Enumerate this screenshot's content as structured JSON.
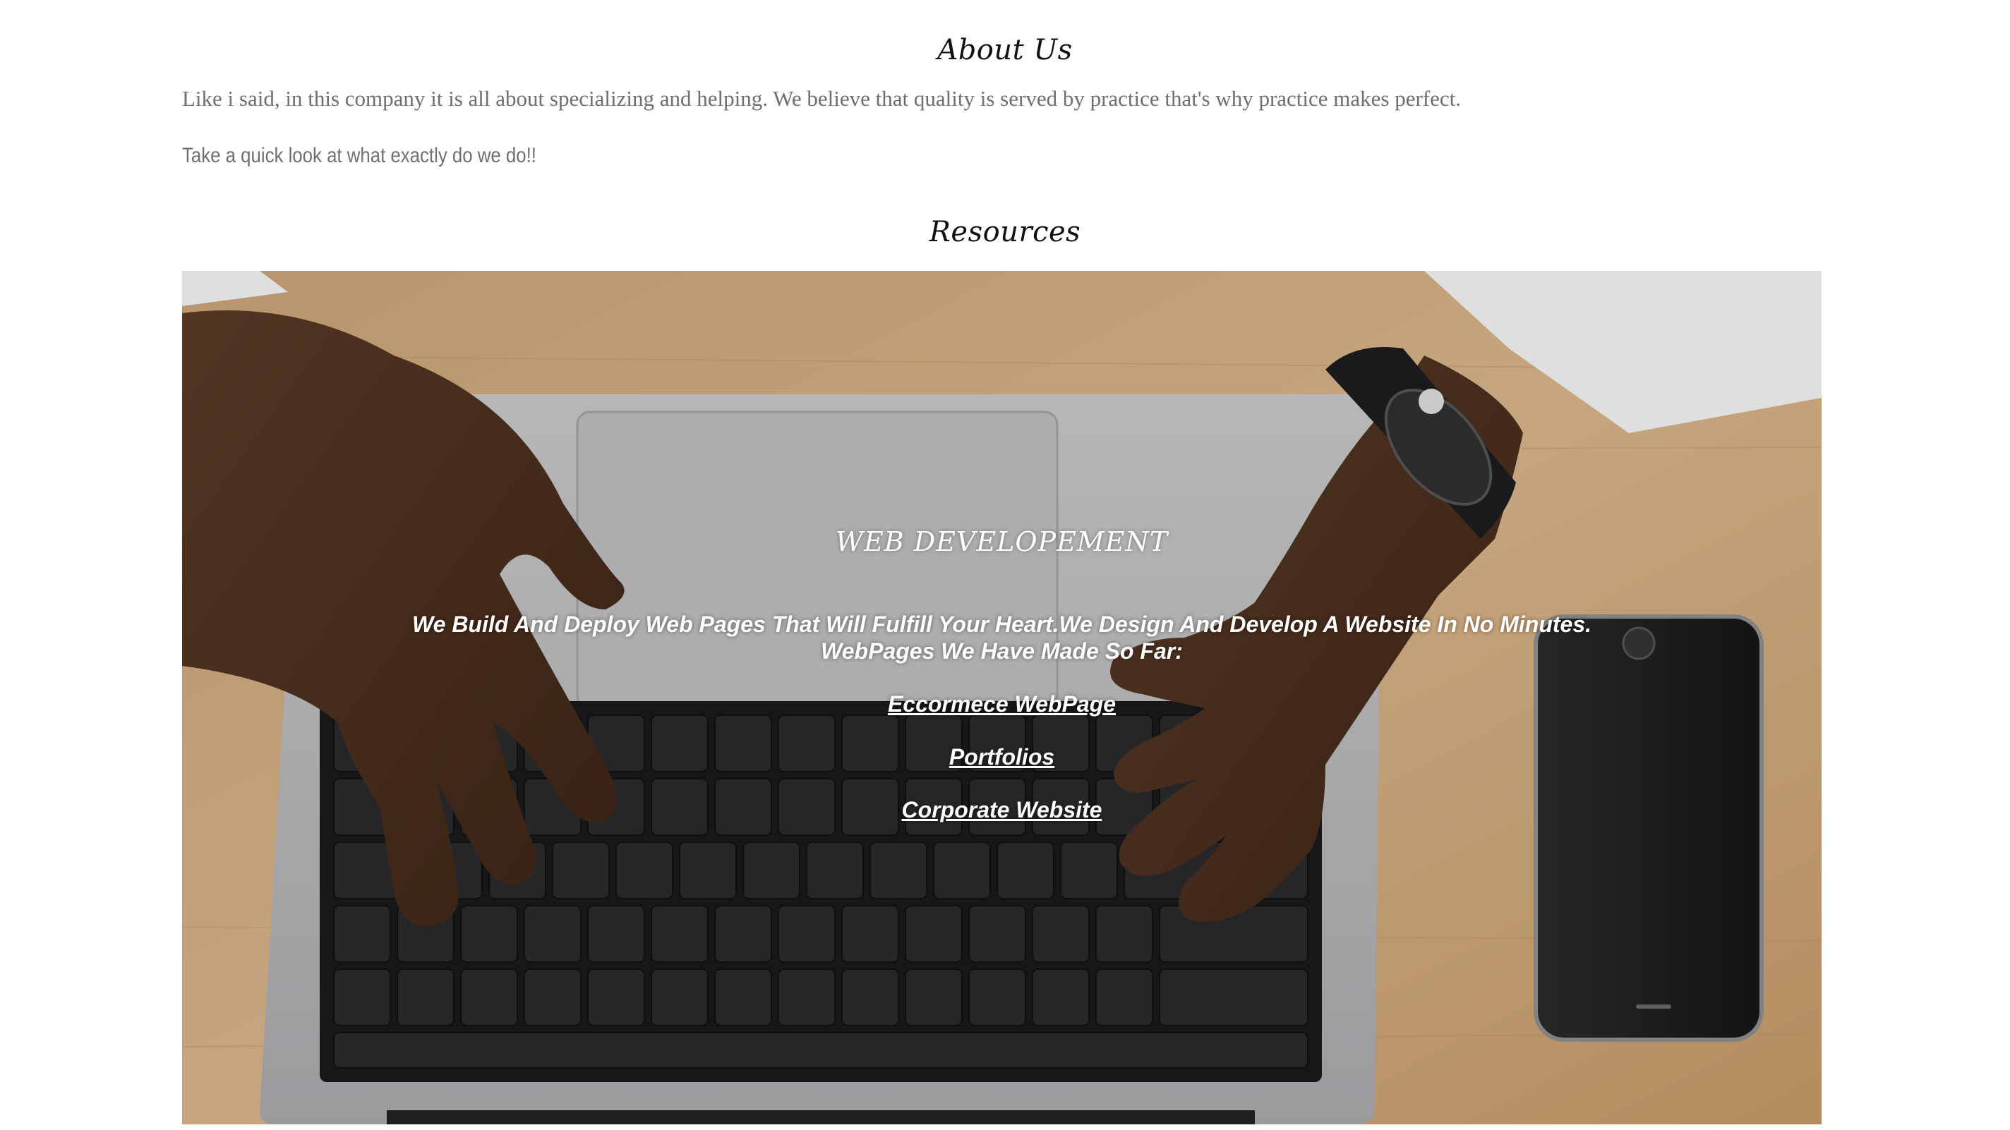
{
  "about": {
    "title": "About Us",
    "paragraph": "Like i said, in this company it is all about specializing and helping. We believe that quality is served by practice that's why practice makes perfect.",
    "subtext": "Take a quick look at what exactly do we do!!"
  },
  "resources": {
    "title": "Resources",
    "hero": {
      "heading": "WEB DEVELOPEMENT",
      "line1": "We Build And Deploy Web Pages That Will Fulfill Your Heart.We Design And Develop A Website In No Minutes.",
      "line2": "WebPages We Have Made So Far:",
      "links": [
        {
          "label": "Eccormece WebPage"
        },
        {
          "label": "Portfolios"
        },
        {
          "label": "Corporate Website"
        }
      ]
    }
  }
}
